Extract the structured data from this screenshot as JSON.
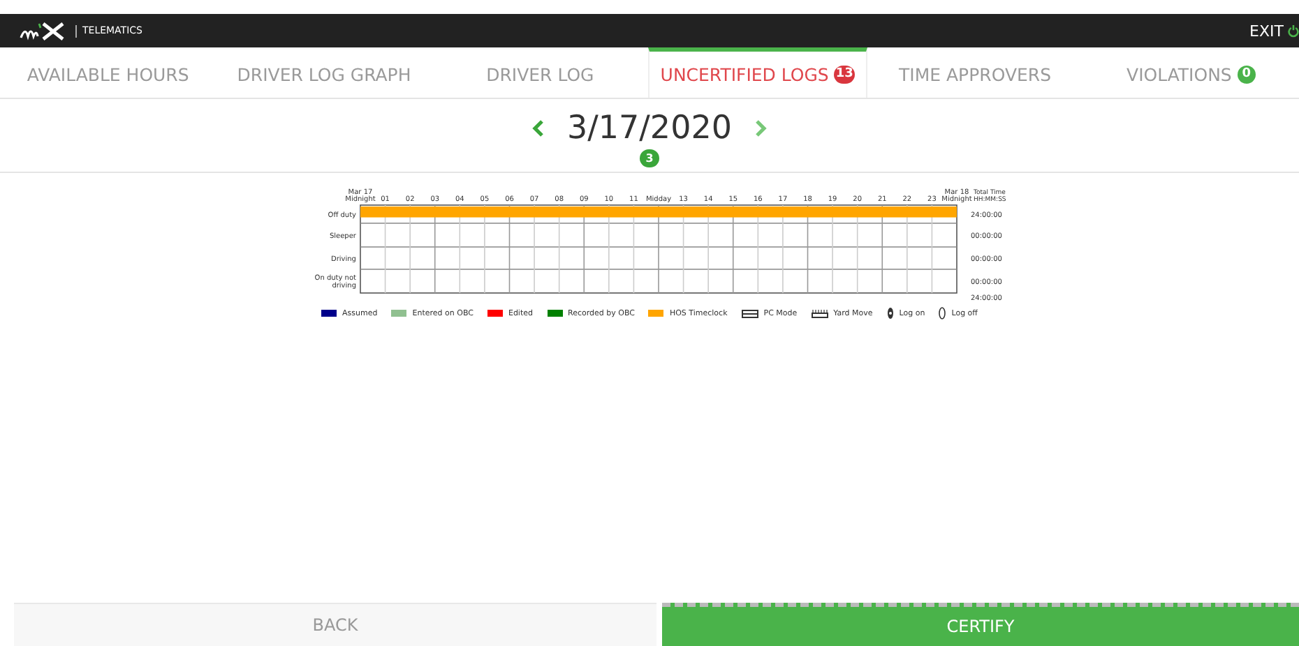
{
  "header": {
    "logo": "TELEMATICS",
    "exit": "EXIT"
  },
  "tabs": [
    {
      "label": "AVAILABLE HOURS",
      "selected": false
    },
    {
      "label": "DRIVER LOG GRAPH",
      "selected": false
    },
    {
      "label": "DRIVER LOG",
      "selected": false
    },
    {
      "label": "UNCERTIFIED LOGS",
      "selected": true,
      "badge": "13",
      "color": "#d9363e"
    },
    {
      "label": "TIME APPROVERS",
      "selected": false
    },
    {
      "label": "VIOLATIONS",
      "selected": false,
      "badge": "0",
      "color": "#4ab34a"
    }
  ],
  "date_nav": {
    "date": "3/17/2020",
    "badge": "3"
  },
  "log_graph": {
    "totals_header": [
      "Total Time",
      "HH:MM:SS"
    ],
    "totals": [
      "24:00:00",
      "00:00:00",
      "00:00:00",
      "00:00:00"
    ],
    "grand_total": "24:00:00",
    "chart_data": {
      "type": "bar",
      "orientation": "horizontal",
      "categories": [
        "Off duty",
        "Sleeper",
        "Driving",
        "On duty not driving"
      ],
      "values": [
        24,
        0,
        0,
        0
      ],
      "xlim": [
        0,
        24
      ],
      "grid": true,
      "xticks": [
        {
          "value": 0,
          "label": "Mar 17 Midnight"
        },
        {
          "value": 1,
          "label": "01"
        },
        {
          "value": 2,
          "label": "02"
        },
        {
          "value": 3,
          "label": "03"
        },
        {
          "value": 4,
          "label": "04"
        },
        {
          "value": 5,
          "label": "05"
        },
        {
          "value": 6,
          "label": "06"
        },
        {
          "value": 7,
          "label": "07"
        },
        {
          "value": 8,
          "label": "08"
        },
        {
          "value": 9,
          "label": "09"
        },
        {
          "value": 10,
          "label": "10"
        },
        {
          "value": 11,
          "label": "11"
        },
        {
          "value": 12,
          "label": "Midday"
        },
        {
          "value": 13,
          "label": "13"
        },
        {
          "value": 14,
          "label": "14"
        },
        {
          "value": 15,
          "label": "15"
        },
        {
          "value": 16,
          "label": "16"
        },
        {
          "value": 17,
          "label": "17"
        },
        {
          "value": 18,
          "label": "18"
        },
        {
          "value": 19,
          "label": "19"
        },
        {
          "value": 20,
          "label": "20"
        },
        {
          "value": 21,
          "label": "21"
        },
        {
          "value": 22,
          "label": "22"
        },
        {
          "value": 23,
          "label": "23"
        },
        {
          "value": 24,
          "label": "Mar 18 Midnight"
        }
      ]
    }
  },
  "legend": [
    {
      "kind": "swatch",
      "label": "Assumed",
      "color": "#00008b"
    },
    {
      "kind": "swatch",
      "label": "Entered on OBC",
      "color": "#90c090"
    },
    {
      "kind": "swatch",
      "label": "Edited",
      "color": "#ff0000"
    },
    {
      "kind": "swatch",
      "label": "Recorded by OBC",
      "color": "#008000"
    },
    {
      "kind": "swatch",
      "label": "HOS Timeclock",
      "color": "#ffa500"
    },
    {
      "kind": "pattern",
      "label": "PC Mode"
    },
    {
      "kind": "ruler",
      "label": "Yard Move"
    },
    {
      "kind": "logon",
      "label": "Log on"
    },
    {
      "kind": "logoff",
      "label": "Log off"
    }
  ],
  "footer": {
    "back": "BACK",
    "certify": "CERTIFY"
  }
}
